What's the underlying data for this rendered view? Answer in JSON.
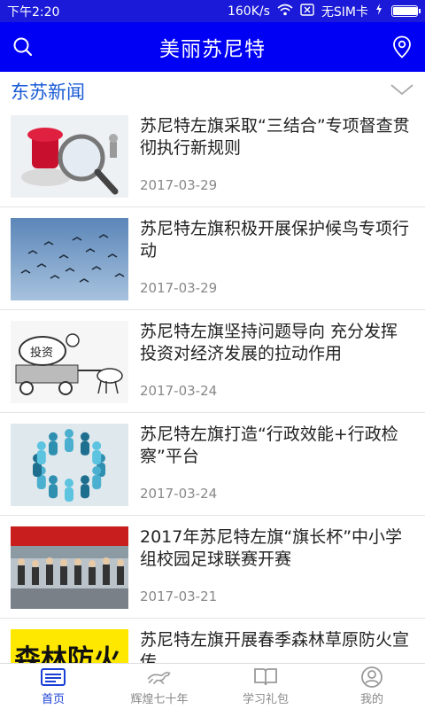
{
  "statusbar": {
    "time": "下午2:20",
    "speed": "160K/s",
    "sim": "无SIM卡",
    "battery_level": 0.95
  },
  "appbar": {
    "title": "美丽苏尼特"
  },
  "section": {
    "title": "东苏新闻"
  },
  "news": [
    {
      "headline": "苏尼特左旗采取“三结合”专项督查贯彻执行新规则",
      "date": "2017-03-29",
      "thumb": "magnifier"
    },
    {
      "headline": "苏尼特左旗积极开展保护候鸟专项行动",
      "date": "2017-03-29",
      "thumb": "birds"
    },
    {
      "headline": "苏尼特左旗坚持问题导向 充分发挥投资对经济发展的拉动作用",
      "date": "2017-03-24",
      "thumb": "cartoon",
      "cartoon_text": "投资"
    },
    {
      "headline": "苏尼特左旗打造“行政效能+行政检察”平台",
      "date": "2017-03-24",
      "thumb": "people-circle"
    },
    {
      "headline": "2017年苏尼特左旗“旗长杯”中小学组校园足球联赛开赛",
      "date": "2017-03-21",
      "thumb": "ceremony"
    },
    {
      "headline": "苏尼特左旗开展春季森林草原防火宣传",
      "date": "",
      "thumb": "banner",
      "banner_text": "森林防火"
    }
  ],
  "tabs": [
    {
      "label": "首页",
      "icon": "newspaper-icon",
      "active": true
    },
    {
      "label": "辉煌七十年",
      "icon": "horse-icon",
      "active": false
    },
    {
      "label": "学习礼包",
      "icon": "book-icon",
      "active": false
    },
    {
      "label": "我的",
      "icon": "user-icon",
      "active": false
    }
  ],
  "colors": {
    "statusbar": "#1a1ad8",
    "appbar": "#0000f5",
    "accent": "#1a5bd6",
    "active_tab": "#1a3fd6"
  }
}
